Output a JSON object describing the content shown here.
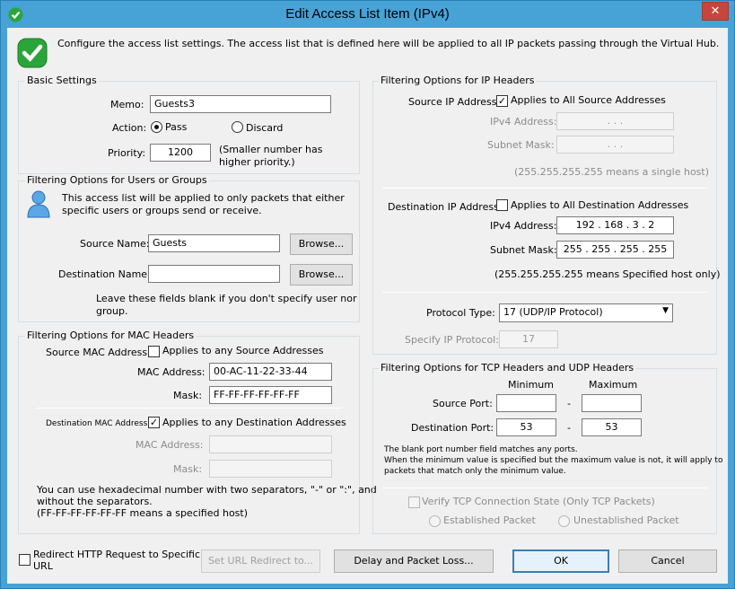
{
  "window": {
    "title": "Edit Access List Item (IPv4)",
    "close_symbol": "✕"
  },
  "header": {
    "description": "Configure the access list settings. The access list that is defined here will be applied to all IP packets passing through the Virtual Hub."
  },
  "basic": {
    "group_label": "Basic Settings",
    "memo_label": "Memo:",
    "memo_value": "Guests3",
    "action_label": "Action:",
    "pass_label": "Pass",
    "discard_label": "Discard",
    "priority_label": "Priority:",
    "priority_value": "1200",
    "priority_hint_1": "(Smaller number has",
    "priority_hint_2": "higher priority.)"
  },
  "users": {
    "group_label": "Filtering Options for Users or Groups",
    "desc_1": "This access list will be applied to only packets that either",
    "desc_2": "specific users or groups send or receive.",
    "source_label": "Source Name:",
    "source_value": "Guests",
    "browse_label": "Browse...",
    "dest_label": "Destination Name:",
    "dest_value": "",
    "hint_1": "Leave these fields blank if you don't specify user nor",
    "hint_2": "group."
  },
  "mac": {
    "group_label": "Filtering Options for MAC Headers",
    "src_label": "Source MAC Address:",
    "src_any_label": "Applies to any Source Addresses",
    "src_mac_label": "MAC Address:",
    "src_mac_value": "00-AC-11-22-33-44",
    "src_mask_label": "Mask:",
    "src_mask_value": "FF-FF-FF-FF-FF-FF",
    "dst_label": "Destination MAC Address:",
    "dst_any_label": "Applies to any Destination Addresses",
    "dst_mac_label": "MAC Address:",
    "dst_mask_label": "Mask:",
    "hint_1": "You can use hexadecimal number with two separators, \"-\" or \":\", and",
    "hint_2": "without the separators.",
    "hint_3": "(FF-FF-FF-FF-FF-FF means a specified host)"
  },
  "ip": {
    "group_label": "Filtering Options for IP Headers",
    "src_label": "Source IP Address:",
    "src_all_label": "Applies to All Source Addresses",
    "src_ipv4_label": "IPv4 Address:",
    "src_ipv4_dots": ".          .          .",
    "src_mask_label": "Subnet Mask:",
    "src_mask_dots": ".          .          .",
    "src_hint": "(255.255.255.255 means a single host)",
    "dst_label": "Destination IP Address:",
    "dst_all_label": "Applies to All Destination Addresses",
    "dst_ipv4_label": "IPv4 Address:",
    "dst_ipv4_value": "192  .  168  .   3   .   2",
    "dst_mask_label": "Subnet Mask:",
    "dst_mask_value": "255  .  255  .  255  .  255",
    "dst_hint": "(255.255.255.255 means Specified host only)",
    "protocol_label": "Protocol Type:",
    "protocol_value": "17 (UDP/IP Protocol)",
    "specify_label": "Specify IP Protocol:",
    "specify_value": "17"
  },
  "tcp": {
    "group_label": "Filtering Options for  TCP Headers and UDP Headers",
    "min_label": "Minimum",
    "max_label": "Maximum",
    "src_port_label": "Source Port:",
    "src_port_min": "",
    "src_port_max": "",
    "dst_port_label": "Destination Port:",
    "dst_port_min": "53",
    "dst_port_max": "53",
    "dash": "-",
    "hint_1": "The blank port number field matches any ports.",
    "hint_2": "When the minimum value is specified but the maximum value is not, it will apply to",
    "hint_3": "packets that match only the minimum value.",
    "verify_label": "Verify TCP Connection State (Only TCP Packets)",
    "established_label": "Established Packet",
    "unestablished_label": "Unestablished Packet"
  },
  "footer": {
    "redirect_label_1": "Redirect HTTP Request to Specific",
    "redirect_label_2": "URL",
    "set_url_label": "Set URL Redirect to...",
    "delay_label": "Delay and Packet Loss...",
    "ok_label": "OK",
    "cancel_label": "Cancel"
  },
  "colors": {
    "titlebar": "#47a2d6",
    "close": "#c7463b",
    "accent": "#3c7fb1",
    "check_green": "#2aa53a"
  }
}
